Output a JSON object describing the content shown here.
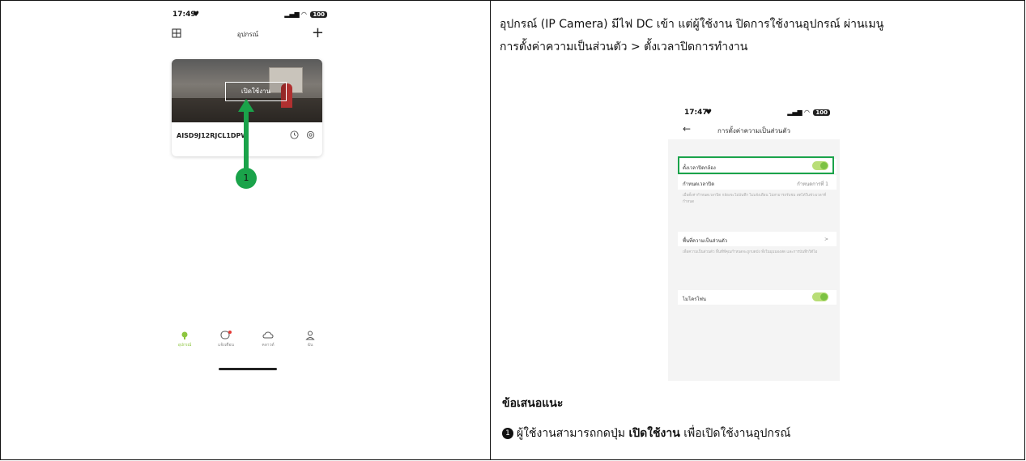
{
  "left_phone": {
    "time": "17:49",
    "battery": "100",
    "title": "อุปกรณ์",
    "enable_button": "เปิดใช้งาน",
    "device_id": "AISD9J12RJCL1DPW",
    "step_number": "1",
    "tabs": [
      {
        "label": "อุปกรณ์",
        "icon": "device-icon"
      },
      {
        "label": "แจ้งเตือน",
        "icon": "message-icon"
      },
      {
        "label": "คลาวด์",
        "icon": "cloud-icon"
      },
      {
        "label": "ฉัน",
        "icon": "user-icon"
      }
    ],
    "accent": "#1aa34a"
  },
  "description": {
    "line1": "อุปกรณ์ (IP Camera) มีไฟ DC เข้า แต่ผู้ใช้งาน ปิดการใช้งานอุปกรณ์ ผ่านเมนู",
    "line2": "การตั้งค่าความเป็นส่วนตัว > ตั้งเวลาปิดการทำงาน"
  },
  "right_phone": {
    "time": "17:47",
    "battery": "100",
    "title": "การตั้งค่าความเป็นส่วนตัว",
    "row_schedule_label": "ตั้งเวลาปิดกล้อง",
    "row_time_label": "กำหนดเวลาปิด",
    "row_time_value": "กำหนดการที่ 1",
    "hint1": "เมื่อตั้งค่ากำหนดเวลาปิด กล้องจะไม่บันทึก ไม่แจ้งเตือน ไม่สามารถรับชม สดได้ในช่วงเวลาที่กำหนด",
    "row_privacy_label": "พื้นที่ความเป็นส่วนตัว",
    "hint2": "เพื่อความเป็นส่วนตัว พื้นที่ที่คุณกำหนดจะถูกบดบัง ทั้งในมุมมองสด และการบันทึกวิดีโอ",
    "row_mic_label": "ไมโครโฟน"
  },
  "recommendation": {
    "heading": "ข้อเสนอแนะ",
    "bullet": "1",
    "text_before": "ผู้ใช้งานสามารถกดปุ่ม ",
    "text_bold": "เปิดใช้งาน",
    "text_after": " เพื่อเปิดใช้งานอุปกรณ์"
  }
}
